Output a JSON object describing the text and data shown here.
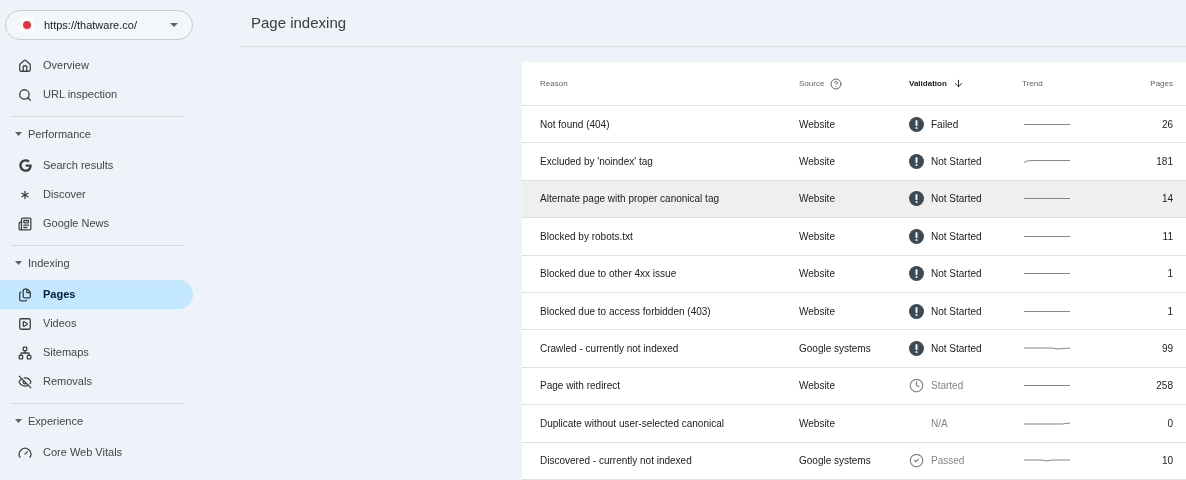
{
  "property_selector": {
    "value": "https://thatware.co/"
  },
  "sidebar": {
    "sections": [
      {
        "items": [
          {
            "label": "Overview",
            "selected": false
          },
          {
            "label": "URL inspection",
            "selected": false
          }
        ]
      },
      {
        "title": "Performance",
        "expanded": true,
        "items": [
          {
            "label": "Search results",
            "selected": false
          },
          {
            "label": "Discover",
            "selected": false
          },
          {
            "label": "Google News",
            "selected": false
          }
        ]
      },
      {
        "title": "Indexing",
        "expanded": true,
        "items": [
          {
            "label": "Pages",
            "selected": true
          },
          {
            "label": "Videos",
            "selected": false
          },
          {
            "label": "Sitemaps",
            "selected": false
          },
          {
            "label": "Removals",
            "selected": false
          }
        ]
      },
      {
        "title": "Experience",
        "expanded": true,
        "items": [
          {
            "label": "Core Web Vitals",
            "selected": false
          }
        ]
      }
    ]
  },
  "page_title": "Page indexing",
  "table": {
    "columns": [
      "Reason",
      "Source",
      "Validation",
      "Trend",
      "Pages"
    ],
    "rows": [
      {
        "reason": "Not found (404)",
        "source": "Website",
        "validation": "Failed",
        "kind": "failed",
        "pages": "26",
        "selected": false
      },
      {
        "reason": "Excluded by 'noindex' tag",
        "source": "Website",
        "validation": "Not Started",
        "kind": "not_started",
        "pages": "181",
        "selected": false
      },
      {
        "reason": "Alternate page with proper canonical tag",
        "source": "Website",
        "validation": "Not Started",
        "kind": "not_started",
        "pages": "14",
        "selected": true
      },
      {
        "reason": "Blocked by robots.txt",
        "source": "Website",
        "validation": "Not Started",
        "kind": "not_started",
        "pages": "11",
        "selected": false
      },
      {
        "reason": "Blocked due to other 4xx issue",
        "source": "Website",
        "validation": "Not Started",
        "kind": "not_started",
        "pages": "1",
        "selected": false
      },
      {
        "reason": "Blocked due to access forbidden (403)",
        "source": "Website",
        "validation": "Not Started",
        "kind": "not_started",
        "pages": "1",
        "selected": false
      },
      {
        "reason": "Crawled - currently not indexed",
        "source": "Google systems",
        "validation": "Not Started",
        "kind": "not_started",
        "pages": "99",
        "selected": false
      },
      {
        "reason": "Page with redirect",
        "source": "Website",
        "validation": "Started",
        "kind": "started",
        "pages": "258",
        "selected": false
      },
      {
        "reason": "Duplicate without user-selected canonical",
        "source": "Website",
        "validation": "N/A",
        "kind": "na",
        "pages": "0",
        "selected": false
      },
      {
        "reason": "Discovered - currently not indexed",
        "source": "Google systems",
        "validation": "Passed",
        "kind": "passed",
        "pages": "10",
        "selected": false
      }
    ]
  }
}
